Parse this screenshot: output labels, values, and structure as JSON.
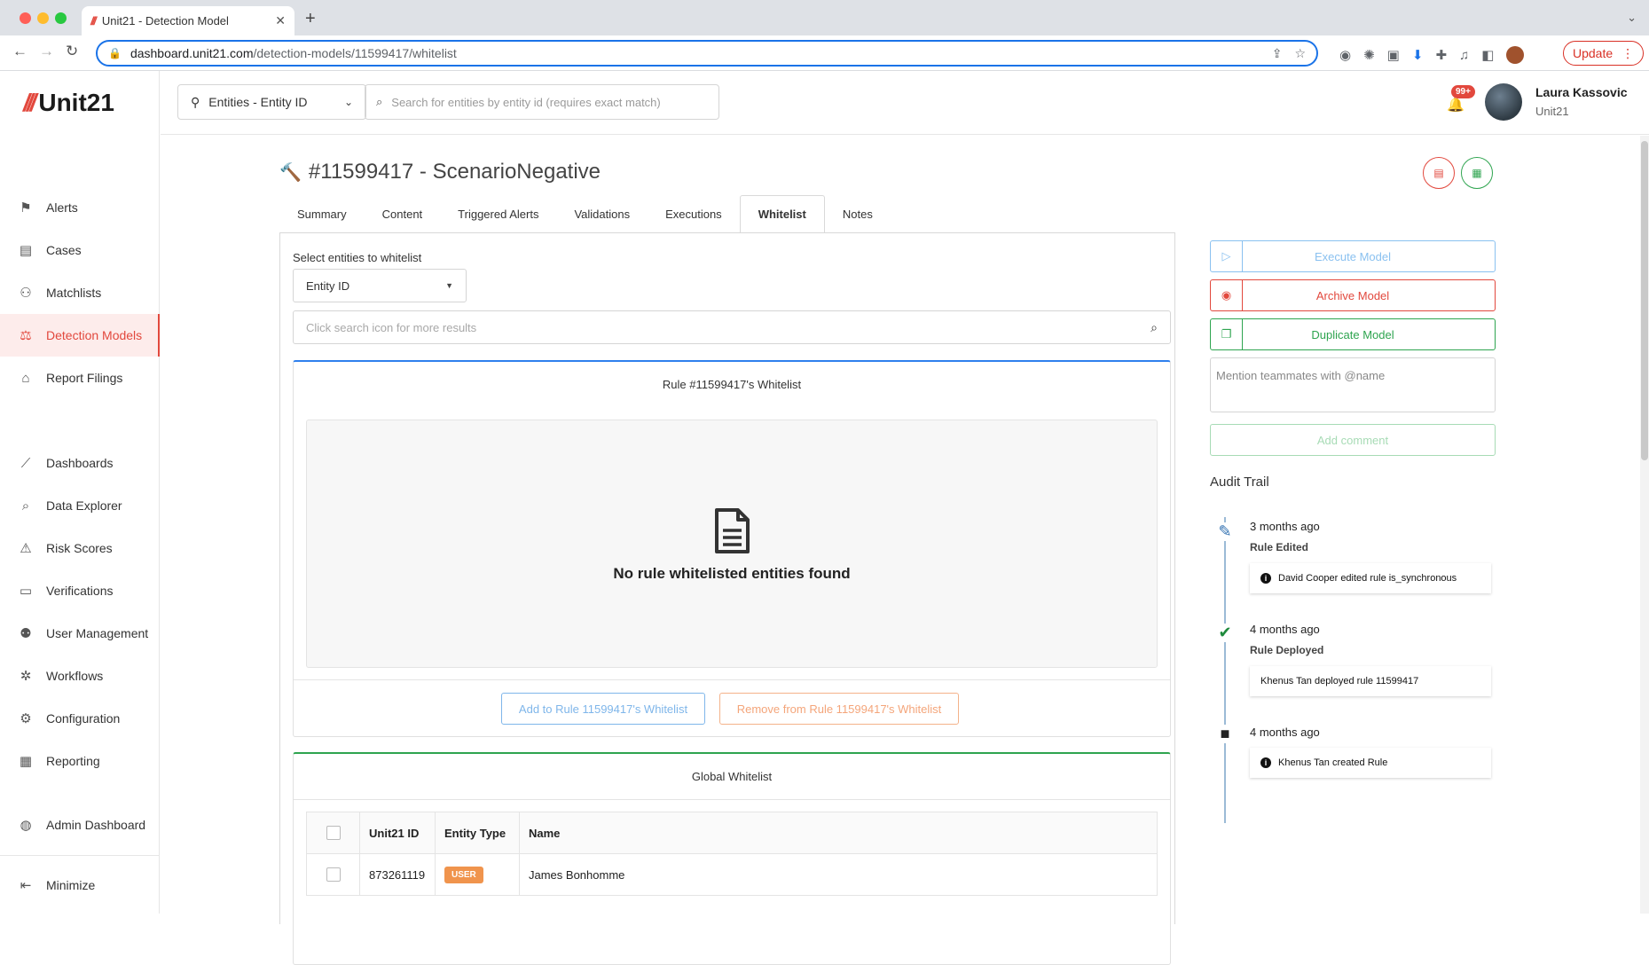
{
  "browser": {
    "tab_title": "Unit21 - Detection Model",
    "url_host": "dashboard.unit21.com",
    "url_path": "/detection-models/11599417/whitelist",
    "update_label": "Update"
  },
  "app": {
    "logo_text": "Unit21",
    "brand_color": "#e2483d"
  },
  "sidebar": {
    "items": [
      {
        "label": "Alerts",
        "icon": "flag-icon"
      },
      {
        "label": "Cases",
        "icon": "briefcase-icon"
      },
      {
        "label": "Matchlists",
        "icon": "user-x-icon"
      },
      {
        "label": "Detection Models",
        "icon": "scale-icon",
        "active": true
      },
      {
        "label": "Report Filings",
        "icon": "bank-icon"
      },
      {
        "label": "Dashboards",
        "icon": "chart-line-icon"
      },
      {
        "label": "Data Explorer",
        "icon": "search-data-icon"
      },
      {
        "label": "Risk Scores",
        "icon": "warning-icon"
      },
      {
        "label": "Verifications",
        "icon": "id-card-icon"
      },
      {
        "label": "User Management",
        "icon": "users-icon"
      },
      {
        "label": "Workflows",
        "icon": "workflow-icon"
      },
      {
        "label": "Configuration",
        "icon": "gear-icon"
      },
      {
        "label": "Reporting",
        "icon": "report-icon"
      },
      {
        "label": "Admin Dashboard",
        "icon": "globe-icon"
      }
    ],
    "minimize_label": "Minimize"
  },
  "topbar": {
    "entity_selector": "Entities - Entity ID",
    "search_placeholder": "Search for entities by entity id (requires exact match)",
    "notification_count": "99+",
    "user_name": "Laura Kassovic",
    "user_org": "Unit21"
  },
  "page": {
    "title": "#11599417 - ScenarioNegative",
    "tabs": [
      "Summary",
      "Content",
      "Triggered Alerts",
      "Validations",
      "Executions",
      "Whitelist",
      "Notes"
    ],
    "active_tab": "Whitelist"
  },
  "whitelist": {
    "select_label": "Select entities to whitelist",
    "dropdown_value": "Entity ID",
    "search_placeholder": "Click search icon for more results",
    "rule_box_title": "Rule #11599417's Whitelist",
    "empty_message": "No rule whitelisted entities found",
    "add_button": "Add to Rule 11599417's Whitelist",
    "remove_button": "Remove from Rule 11599417's Whitelist",
    "global_title": "Global Whitelist",
    "columns": [
      "Unit21 ID",
      "Entity Type",
      "Name"
    ],
    "rows": [
      {
        "unit21_id": "873261119",
        "entity_type": "USER",
        "name": "James Bonhomme"
      }
    ]
  },
  "actions": {
    "execute": "Execute Model",
    "archive": "Archive Model",
    "duplicate": "Duplicate Model",
    "comment_placeholder": "Mention teammates with @name",
    "add_comment": "Add comment"
  },
  "audit": {
    "title": "Audit Trail",
    "events": [
      {
        "date": "3 months ago",
        "type": "Rule Edited",
        "detail": "David Cooper edited rule is_synchronous",
        "icon": "pencil-icon",
        "has_info": true
      },
      {
        "date": "4 months ago",
        "type": "Rule Deployed",
        "detail": "Khenus Tan deployed rule 11599417",
        "icon": "check-icon",
        "has_info": false
      },
      {
        "date": "4 months ago",
        "type": "",
        "detail": "Khenus Tan created Rule",
        "icon": "briefcase-icon",
        "has_info": true
      }
    ]
  }
}
